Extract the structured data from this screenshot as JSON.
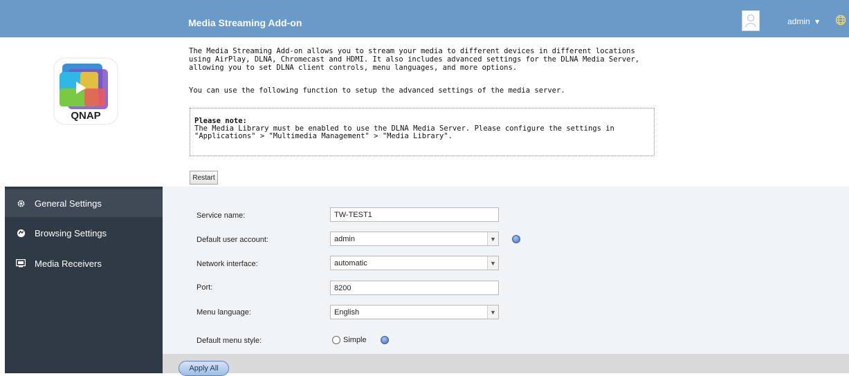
{
  "header": {
    "title": "Media Streaming Add-on",
    "user": "admin"
  },
  "logo": {
    "text": "QNAP"
  },
  "intro": {
    "paragraph1": "The Media Streaming Add-on allows you to stream your media to different devices in different locations using AirPlay, DLNA, Chromecast and HDMI. It also includes advanced settings for the DLNA Media Server, allowing you to set DLNA client controls, menu languages, and more options.",
    "paragraph2": "You can use the following function to setup the advanced settings of the media server."
  },
  "note": {
    "title": "Please note:",
    "body": "The Media Library must be enabled to use the DLNA Media Server. Please configure the settings in \"Applications\" > \"Multimedia Management\" > \"Media Library\"."
  },
  "buttons": {
    "restart": "Restart",
    "apply_all": "Apply All"
  },
  "sidebar": {
    "items": [
      {
        "label": "General Settings",
        "icon": "gear-icon",
        "active": true
      },
      {
        "label": "Browsing Settings",
        "icon": "browse-icon",
        "active": false
      },
      {
        "label": "Media Receivers",
        "icon": "receiver-icon",
        "active": false
      }
    ]
  },
  "form": {
    "service_name": {
      "label": "Service name:",
      "value": "TW-TEST1"
    },
    "default_user": {
      "label": "Default user account:",
      "value": "admin"
    },
    "network_interface": {
      "label": "Network interface:",
      "value": "automatic"
    },
    "port": {
      "label": "Port:",
      "value": "8200"
    },
    "menu_language": {
      "label": "Menu language:",
      "value": "English"
    },
    "menu_style": {
      "label": "Default menu style:",
      "option": "Simple"
    }
  },
  "colors": {
    "topbar": "#6a9ac7",
    "sidebar": "#2f3a45",
    "content_bg": "#f1f4f7"
  }
}
